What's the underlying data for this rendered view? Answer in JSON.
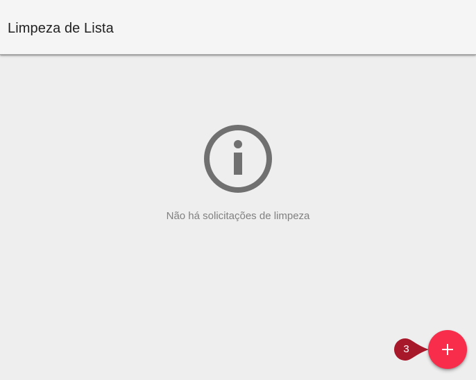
{
  "app_bar": {
    "title": "Limpeza de Lista"
  },
  "empty_state": {
    "icon": "info-icon",
    "message": "Não há solicitações de limpeza"
  },
  "fab": {
    "icon": "plus-icon",
    "color": "#f72d4b"
  },
  "step_badge": {
    "label": "3",
    "color": "#a8182b"
  },
  "colors": {
    "background": "#eeeeee",
    "app_bar": "#f5f5f5",
    "icon_gray": "#707070",
    "text_gray": "#808080"
  }
}
